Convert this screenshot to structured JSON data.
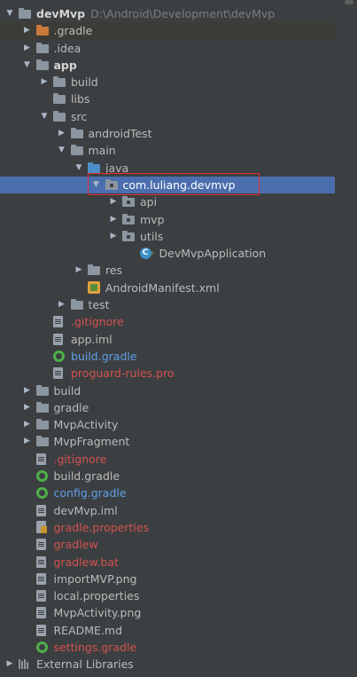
{
  "project": {
    "name": "devMvp",
    "path": "D:\\Android\\Development\\devMvp"
  },
  "tree": [
    {
      "label": "devMvp",
      "path": "D:\\Android\\Development\\devMvp",
      "depth": 0,
      "arrow": "open",
      "icon": "module-folder",
      "style": "bold",
      "name": "project-root"
    },
    {
      "label": ".gradle",
      "depth": 1,
      "arrow": "closed",
      "icon": "folder-orange",
      "style": "normal",
      "name": "tree-item-gradle-dir",
      "hl": "gradle"
    },
    {
      "label": ".idea",
      "depth": 1,
      "arrow": "closed",
      "icon": "folder",
      "style": "normal",
      "name": "tree-item-idea-dir"
    },
    {
      "label": "app",
      "depth": 1,
      "arrow": "open",
      "icon": "module-folder",
      "style": "bold",
      "name": "tree-item-app-module"
    },
    {
      "label": "build",
      "depth": 2,
      "arrow": "closed",
      "icon": "folder",
      "style": "normal",
      "name": "tree-item-app-build"
    },
    {
      "label": "libs",
      "depth": 2,
      "arrow": "none",
      "icon": "folder",
      "style": "normal",
      "name": "tree-item-libs"
    },
    {
      "label": "src",
      "depth": 2,
      "arrow": "open",
      "icon": "folder",
      "style": "normal",
      "name": "tree-item-src"
    },
    {
      "label": "androidTest",
      "depth": 3,
      "arrow": "closed",
      "icon": "folder",
      "style": "normal",
      "name": "tree-item-androidtest"
    },
    {
      "label": "main",
      "depth": 3,
      "arrow": "open",
      "icon": "folder",
      "style": "normal",
      "name": "tree-item-main"
    },
    {
      "label": "java",
      "depth": 4,
      "arrow": "open",
      "icon": "folder-blue",
      "style": "normal",
      "name": "tree-item-java"
    },
    {
      "label": "com.luliang.devmvp",
      "depth": 5,
      "arrow": "open",
      "icon": "package",
      "style": "white",
      "name": "tree-item-package-devmvp",
      "selected": true
    },
    {
      "label": "api",
      "depth": 6,
      "arrow": "closed",
      "icon": "package",
      "style": "normal",
      "name": "tree-item-package-api"
    },
    {
      "label": "mvp",
      "depth": 6,
      "arrow": "closed",
      "icon": "package",
      "style": "normal",
      "name": "tree-item-package-mvp"
    },
    {
      "label": "utils",
      "depth": 6,
      "arrow": "closed",
      "icon": "package",
      "style": "normal",
      "name": "tree-item-package-utils"
    },
    {
      "label": "DevMvpApplication",
      "depth": 7,
      "arrow": "none",
      "icon": "class",
      "style": "normal",
      "name": "tree-item-devmvpapplication"
    },
    {
      "label": "res",
      "depth": 4,
      "arrow": "closed",
      "icon": "folder-res",
      "style": "normal",
      "name": "tree-item-res"
    },
    {
      "label": "AndroidManifest.xml",
      "depth": 4,
      "arrow": "none",
      "icon": "xml",
      "style": "normal",
      "name": "tree-item-androidmanifest"
    },
    {
      "label": "test",
      "depth": 3,
      "arrow": "closed",
      "icon": "folder",
      "style": "normal",
      "name": "tree-item-test"
    },
    {
      "label": ".gitignore",
      "depth": 2,
      "arrow": "none",
      "icon": "file",
      "style": "red",
      "name": "tree-item-app-gitignore"
    },
    {
      "label": "app.iml",
      "depth": 2,
      "arrow": "none",
      "icon": "file",
      "style": "normal",
      "name": "tree-item-app-iml"
    },
    {
      "label": "build.gradle",
      "depth": 2,
      "arrow": "none",
      "icon": "gradle",
      "style": "blue",
      "name": "tree-item-app-build-gradle"
    },
    {
      "label": "proguard-rules.pro",
      "depth": 2,
      "arrow": "none",
      "icon": "file",
      "style": "red",
      "name": "tree-item-proguard"
    },
    {
      "label": "build",
      "depth": 1,
      "arrow": "closed",
      "icon": "folder",
      "style": "normal",
      "name": "tree-item-root-build"
    },
    {
      "label": "gradle",
      "depth": 1,
      "arrow": "closed",
      "icon": "folder",
      "style": "normal",
      "name": "tree-item-gradle-folder"
    },
    {
      "label": "MvpActivity",
      "depth": 1,
      "arrow": "closed",
      "icon": "folder",
      "style": "normal",
      "name": "tree-item-mvpactivity"
    },
    {
      "label": "MvpFragment",
      "depth": 1,
      "arrow": "closed",
      "icon": "folder",
      "style": "normal",
      "name": "tree-item-mvpfragment"
    },
    {
      "label": ".gitignore",
      "depth": 1,
      "arrow": "none",
      "icon": "file",
      "style": "red",
      "name": "tree-item-root-gitignore"
    },
    {
      "label": "build.gradle",
      "depth": 1,
      "arrow": "none",
      "icon": "gradle",
      "style": "normal",
      "name": "tree-item-root-build-gradle"
    },
    {
      "label": "config.gradle",
      "depth": 1,
      "arrow": "none",
      "icon": "gradle",
      "style": "blue",
      "name": "tree-item-config-gradle"
    },
    {
      "label": "devMvp.iml",
      "depth": 1,
      "arrow": "none",
      "icon": "file",
      "style": "normal",
      "name": "tree-item-devmvp-iml"
    },
    {
      "label": "gradle.properties",
      "depth": 1,
      "arrow": "none",
      "icon": "props",
      "style": "red",
      "name": "tree-item-gradle-properties"
    },
    {
      "label": "gradlew",
      "depth": 1,
      "arrow": "none",
      "icon": "file",
      "style": "red",
      "name": "tree-item-gradlew"
    },
    {
      "label": "gradlew.bat",
      "depth": 1,
      "arrow": "none",
      "icon": "file",
      "style": "red",
      "name": "tree-item-gradlew-bat"
    },
    {
      "label": "importMVP.png",
      "depth": 1,
      "arrow": "none",
      "icon": "file",
      "style": "normal",
      "name": "tree-item-importmvp-png"
    },
    {
      "label": "local.properties",
      "depth": 1,
      "arrow": "none",
      "icon": "file",
      "style": "normal",
      "name": "tree-item-local-properties"
    },
    {
      "label": "MvpActivity.png",
      "depth": 1,
      "arrow": "none",
      "icon": "file",
      "style": "normal",
      "name": "tree-item-mvpactivity-png"
    },
    {
      "label": "README.md",
      "depth": 1,
      "arrow": "none",
      "icon": "file",
      "style": "normal",
      "name": "tree-item-readme"
    },
    {
      "label": "settings.gradle",
      "depth": 1,
      "arrow": "none",
      "icon": "gradle",
      "style": "red",
      "name": "tree-item-settings-gradle"
    },
    {
      "label": "External Libraries",
      "depth": 0,
      "arrow": "closed",
      "icon": "libraries",
      "style": "normal",
      "name": "tree-item-external-libraries"
    }
  ],
  "colors": {
    "background": "#3c3f41",
    "selection": "#4b6eaf",
    "text": "#bbbbbb",
    "untracked_red": "#d2524f",
    "modified_blue": "#5f9ee8",
    "highlight_box": "#e03030"
  }
}
